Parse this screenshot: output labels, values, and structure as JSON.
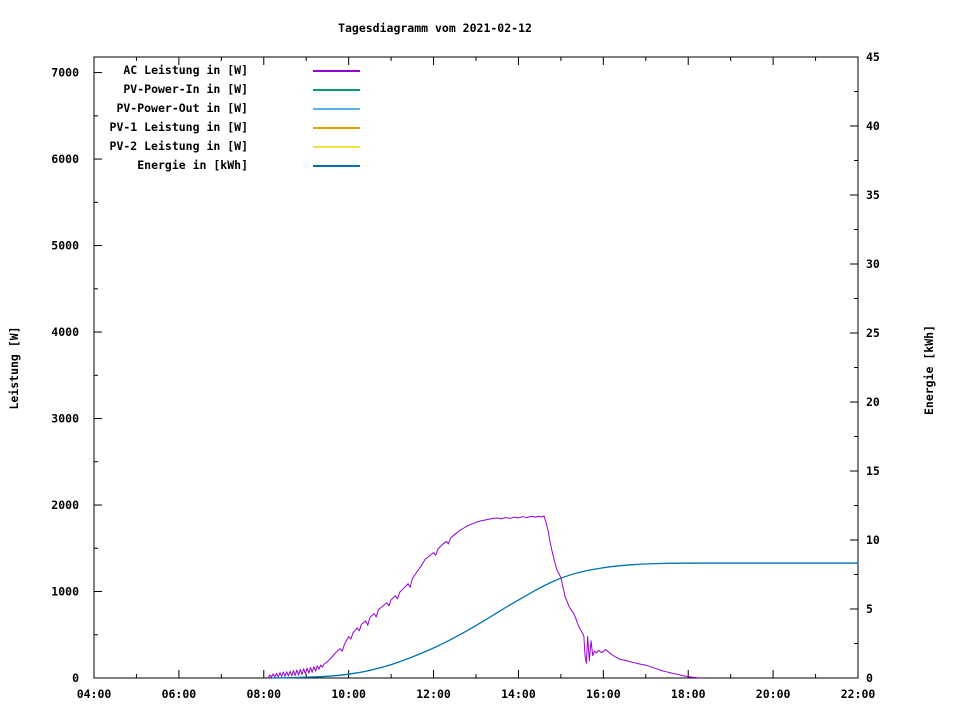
{
  "chart_data": {
    "type": "line",
    "title": "Tagesdiagramm vom 2021-02-12",
    "x_axis": {
      "range_hours": [
        4,
        22
      ],
      "major_tick_hours": [
        4,
        6,
        8,
        10,
        12,
        14,
        16,
        18,
        20,
        22
      ],
      "minor_tick_hours": [
        5,
        7,
        9,
        11,
        13,
        15,
        17,
        19,
        21
      ],
      "tick_labels": [
        "04:00",
        "06:00",
        "08:00",
        "10:00",
        "12:00",
        "14:00",
        "16:00",
        "18:00",
        "20:00",
        "22:00"
      ]
    },
    "y_left": {
      "label": "Leistung [W]",
      "range": [
        0,
        7180
      ],
      "major_ticks": [
        0,
        1000,
        2000,
        3000,
        4000,
        5000,
        6000,
        7000
      ],
      "tick_labels": [
        "0",
        "1000",
        "2000",
        "3000",
        "4000",
        "5000",
        "6000",
        "7000"
      ],
      "minor_ticks": [
        500,
        1500,
        2500,
        3500,
        4500,
        5500,
        6500
      ]
    },
    "y_right": {
      "label": "Energie [kWh]",
      "range": [
        0,
        45
      ],
      "major_ticks": [
        0,
        5,
        10,
        15,
        20,
        25,
        30,
        35,
        40,
        45
      ],
      "tick_labels": [
        "0",
        "5",
        "10",
        "15",
        "20",
        "25",
        "30",
        "35",
        "40",
        "45"
      ],
      "minor_ticks": [
        2.5,
        7.5,
        12.5,
        17.5,
        22.5,
        27.5,
        32.5,
        37.5,
        42.5
      ]
    },
    "grid": false,
    "legend_position": "top-left-inside",
    "series": [
      {
        "name": "AC Leistung in [W]",
        "color": "#9400d3",
        "axis": "left",
        "smooth": false,
        "points": [
          [
            8.1,
            2
          ],
          [
            8.14,
            35
          ],
          [
            8.18,
            10
          ],
          [
            8.22,
            48
          ],
          [
            8.26,
            12
          ],
          [
            8.3,
            55
          ],
          [
            8.34,
            14
          ],
          [
            8.38,
            62
          ],
          [
            8.42,
            18
          ],
          [
            8.46,
            68
          ],
          [
            8.5,
            20
          ],
          [
            8.54,
            72
          ],
          [
            8.58,
            24
          ],
          [
            8.62,
            78
          ],
          [
            8.66,
            26
          ],
          [
            8.7,
            85
          ],
          [
            8.74,
            30
          ],
          [
            8.78,
            92
          ],
          [
            8.82,
            34
          ],
          [
            8.86,
            100
          ],
          [
            8.9,
            40
          ],
          [
            8.94,
            108
          ],
          [
            8.98,
            48
          ],
          [
            9.02,
            115
          ],
          [
            9.06,
            55
          ],
          [
            9.1,
            122
          ],
          [
            9.14,
            65
          ],
          [
            9.18,
            130
          ],
          [
            9.22,
            80
          ],
          [
            9.26,
            140
          ],
          [
            9.3,
            100
          ],
          [
            9.34,
            150
          ],
          [
            9.38,
            125
          ],
          [
            9.42,
            160
          ],
          [
            9.5,
            190
          ],
          [
            9.6,
            240
          ],
          [
            9.7,
            295
          ],
          [
            9.8,
            340
          ],
          [
            9.85,
            310
          ],
          [
            9.9,
            390
          ],
          [
            10.0,
            480
          ],
          [
            10.05,
            450
          ],
          [
            10.1,
            520
          ],
          [
            10.2,
            580
          ],
          [
            10.25,
            545
          ],
          [
            10.3,
            620
          ],
          [
            10.4,
            660
          ],
          [
            10.45,
            610
          ],
          [
            10.5,
            700
          ],
          [
            10.6,
            745
          ],
          [
            10.65,
            705
          ],
          [
            10.7,
            790
          ],
          [
            10.8,
            830
          ],
          [
            10.9,
            870
          ],
          [
            10.95,
            835
          ],
          [
            11.0,
            905
          ],
          [
            11.1,
            950
          ],
          [
            11.15,
            915
          ],
          [
            11.2,
            990
          ],
          [
            11.3,
            1040
          ],
          [
            11.4,
            1090
          ],
          [
            11.45,
            1050
          ],
          [
            11.5,
            1150
          ],
          [
            11.6,
            1220
          ],
          [
            11.7,
            1290
          ],
          [
            11.75,
            1330
          ],
          [
            11.8,
            1370
          ],
          [
            11.9,
            1410
          ],
          [
            12.0,
            1450
          ],
          [
            12.05,
            1420
          ],
          [
            12.1,
            1490
          ],
          [
            12.2,
            1540
          ],
          [
            12.3,
            1580
          ],
          [
            12.35,
            1550
          ],
          [
            12.4,
            1620
          ],
          [
            12.5,
            1660
          ],
          [
            12.6,
            1700
          ],
          [
            12.7,
            1730
          ],
          [
            12.8,
            1760
          ],
          [
            12.9,
            1780
          ],
          [
            13.0,
            1800
          ],
          [
            13.1,
            1815
          ],
          [
            13.2,
            1825
          ],
          [
            13.3,
            1835
          ],
          [
            13.4,
            1845
          ],
          [
            13.5,
            1850
          ],
          [
            13.6,
            1840
          ],
          [
            13.7,
            1855
          ],
          [
            13.8,
            1845
          ],
          [
            13.9,
            1860
          ],
          [
            14.0,
            1850
          ],
          [
            14.1,
            1865
          ],
          [
            14.2,
            1855
          ],
          [
            14.3,
            1870
          ],
          [
            14.4,
            1860
          ],
          [
            14.5,
            1870
          ],
          [
            14.55,
            1860
          ],
          [
            14.6,
            1875
          ],
          [
            14.65,
            1800
          ],
          [
            14.7,
            1700
          ],
          [
            14.75,
            1560
          ],
          [
            14.8,
            1450
          ],
          [
            14.85,
            1350
          ],
          [
            14.9,
            1260
          ],
          [
            14.95,
            1210
          ],
          [
            15.0,
            1160
          ],
          [
            15.05,
            1050
          ],
          [
            15.1,
            940
          ],
          [
            15.15,
            880
          ],
          [
            15.2,
            820
          ],
          [
            15.25,
            780
          ],
          [
            15.3,
            745
          ],
          [
            15.35,
            690
          ],
          [
            15.4,
            620
          ],
          [
            15.45,
            570
          ],
          [
            15.5,
            525
          ],
          [
            15.54,
            490
          ],
          [
            15.57,
            250
          ],
          [
            15.6,
            170
          ],
          [
            15.63,
            480
          ],
          [
            15.67,
            200
          ],
          [
            15.71,
            430
          ],
          [
            15.75,
            260
          ],
          [
            15.79,
            310
          ],
          [
            15.84,
            290
          ],
          [
            15.89,
            320
          ],
          [
            15.95,
            295
          ],
          [
            16.0,
            305
          ],
          [
            16.05,
            330
          ],
          [
            16.1,
            310
          ],
          [
            16.2,
            270
          ],
          [
            16.3,
            240
          ],
          [
            16.4,
            215
          ],
          [
            16.5,
            205
          ],
          [
            16.6,
            192
          ],
          [
            16.7,
            180
          ],
          [
            16.8,
            168
          ],
          [
            16.9,
            158
          ],
          [
            17.0,
            148
          ],
          [
            17.1,
            132
          ],
          [
            17.2,
            115
          ],
          [
            17.3,
            98
          ],
          [
            17.4,
            82
          ],
          [
            17.5,
            70
          ],
          [
            17.6,
            58
          ],
          [
            17.7,
            47
          ],
          [
            17.8,
            36
          ],
          [
            17.9,
            25
          ],
          [
            18.0,
            16
          ],
          [
            18.1,
            9
          ],
          [
            18.2,
            4
          ],
          [
            18.3,
            1
          ]
        ]
      },
      {
        "name": "PV-Power-In in [W]",
        "color": "#009e73",
        "axis": "left",
        "smooth": false,
        "points": []
      },
      {
        "name": "PV-Power-Out in [W]",
        "color": "#56b4e9",
        "axis": "left",
        "smooth": false,
        "points": []
      },
      {
        "name": "PV-1 Leistung in [W]",
        "color": "#e69f00",
        "axis": "left",
        "smooth": false,
        "points": []
      },
      {
        "name": "PV-2 Leistung in [W]",
        "color": "#f0e442",
        "axis": "left",
        "smooth": false,
        "points": []
      },
      {
        "name": "Energie in [kWh]",
        "color": "#0072b2",
        "axis": "right",
        "smooth": true,
        "points": [
          [
            8.2,
            0
          ],
          [
            8.6,
            0.02
          ],
          [
            9.0,
            0.06
          ],
          [
            9.4,
            0.1
          ],
          [
            9.8,
            0.2
          ],
          [
            10.0,
            0.28
          ],
          [
            10.3,
            0.42
          ],
          [
            10.6,
            0.62
          ],
          [
            11.0,
            0.95
          ],
          [
            11.4,
            1.4
          ],
          [
            11.8,
            1.9
          ],
          [
            12.2,
            2.45
          ],
          [
            12.6,
            3.1
          ],
          [
            13.0,
            3.8
          ],
          [
            13.4,
            4.55
          ],
          [
            13.8,
            5.3
          ],
          [
            14.2,
            6.0
          ],
          [
            14.6,
            6.7
          ],
          [
            15.0,
            7.25
          ],
          [
            15.4,
            7.65
          ],
          [
            15.8,
            7.9
          ],
          [
            16.2,
            8.08
          ],
          [
            16.6,
            8.2
          ],
          [
            17.0,
            8.27
          ],
          [
            17.5,
            8.31
          ],
          [
            18.0,
            8.33
          ],
          [
            19.0,
            8.33
          ],
          [
            20.0,
            8.33
          ],
          [
            21.0,
            8.33
          ],
          [
            22.0,
            8.33
          ]
        ]
      }
    ]
  }
}
